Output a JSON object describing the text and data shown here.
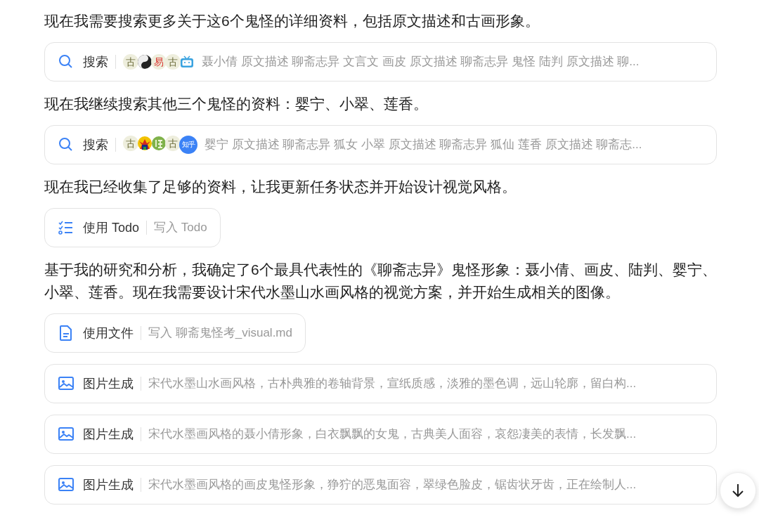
{
  "messages": [
    {
      "kind": "text",
      "text": "现在我需要搜索更多关于这6个鬼怪的详细资料，包括原文描述和古画形象。"
    },
    {
      "kind": "search",
      "label": "搜索",
      "sources": [
        {
          "kind": "glyph",
          "label": "古",
          "color": "#6b6b3a"
        },
        {
          "kind": "yinyang"
        },
        {
          "kind": "glyph",
          "label": "易",
          "color": "#d9302c"
        },
        {
          "kind": "glyph",
          "label": "古",
          "color": "#6b6b3a"
        },
        {
          "kind": "tv"
        }
      ],
      "detail": "聂小倩 原文描述 聊斋志异 文言文 画皮 原文描述 聊斋志异 鬼怪 陆判 原文描述 聊..."
    },
    {
      "kind": "text",
      "text": "现在我继续搜索其他三个鬼怪的资料：婴宁、小翠、莲香。"
    },
    {
      "kind": "search",
      "label": "搜索",
      "sources": [
        {
          "kind": "glyph",
          "label": "古",
          "color": "#6b6b3a"
        },
        {
          "kind": "emblem"
        },
        {
          "kind": "leaf"
        },
        {
          "kind": "glyph",
          "label": "古",
          "color": "#6b6b3a"
        },
        {
          "kind": "badge",
          "label": "知乎",
          "color": "#3b82f6"
        }
      ],
      "detail": "婴宁 原文描述 聊斋志异 狐女 小翠 原文描述 聊斋志异 狐仙 莲香 原文描述 聊斋志..."
    },
    {
      "kind": "text",
      "text": "现在我已经收集了足够的资料，让我更新任务状态并开始设计视觉风格。"
    },
    {
      "kind": "todo",
      "label": "使用 Todo",
      "detail": "写入 Todo"
    },
    {
      "kind": "text",
      "text": "基于我的研究和分析，我确定了6个最具代表性的《聊斋志异》鬼怪形象：聂小倩、画皮、陆判、婴宁、小翠、莲香。现在我需要设计宋代水墨山水画风格的视觉方案，并开始生成相关的图像。"
    },
    {
      "kind": "file",
      "label": "使用文件",
      "detail": "写入 聊斋鬼怪考_visual.md"
    },
    {
      "kind": "image",
      "label": "图片生成",
      "detail": "宋代水墨山水画风格，古朴典雅的卷轴背景，宣纸质感，淡雅的墨色调，远山轮廓，留白构..."
    },
    {
      "kind": "image",
      "label": "图片生成",
      "detail": "宋代水墨画风格的聂小倩形象，白衣飘飘的女鬼，古典美人面容，哀怨凄美的表情，长发飘..."
    },
    {
      "kind": "image",
      "label": "图片生成",
      "detail": "宋代水墨画风格的画皮鬼怪形象，狰狞的恶鬼面容，翠绿色脸皮，锯齿状牙齿，正在绘制人..."
    }
  ]
}
